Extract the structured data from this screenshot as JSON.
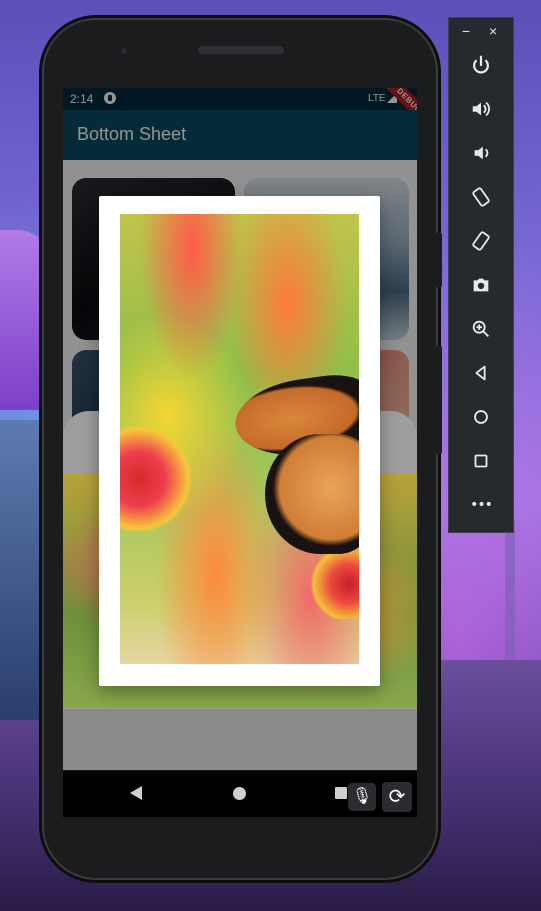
{
  "status_bar": {
    "time": "2:14",
    "network": "LTE",
    "debug_label": "DEBUG"
  },
  "app_bar": {
    "title": "Bottom Sheet"
  },
  "emulator_toolbar": {
    "window_controls": {
      "minimize": "−",
      "close": "×"
    },
    "buttons": [
      {
        "name": "power",
        "icon": "power-icon"
      },
      {
        "name": "volume-up",
        "icon": "volume-up-icon"
      },
      {
        "name": "volume-down",
        "icon": "volume-down-icon"
      },
      {
        "name": "rotate-left",
        "icon": "rotate-left-icon"
      },
      {
        "name": "rotate-right",
        "icon": "rotate-right-icon"
      },
      {
        "name": "screenshot",
        "icon": "camera-icon"
      },
      {
        "name": "zoom",
        "icon": "zoom-in-icon"
      },
      {
        "name": "back",
        "icon": "back-triangle-icon"
      },
      {
        "name": "home",
        "icon": "home-circle-icon"
      },
      {
        "name": "overview",
        "icon": "overview-square-icon"
      },
      {
        "name": "more",
        "icon": "more-dots-icon",
        "label": "•••"
      }
    ]
  },
  "nav_bar": {
    "back_icon": "back-icon",
    "home_icon": "home-icon",
    "recents_icon": "recents-icon"
  },
  "overlay_buttons": {
    "mic_icon": "microphone-icon",
    "rotate_icon": "rotate-icon"
  },
  "dialog": {
    "image": "butterfly-on-flower-photo"
  }
}
